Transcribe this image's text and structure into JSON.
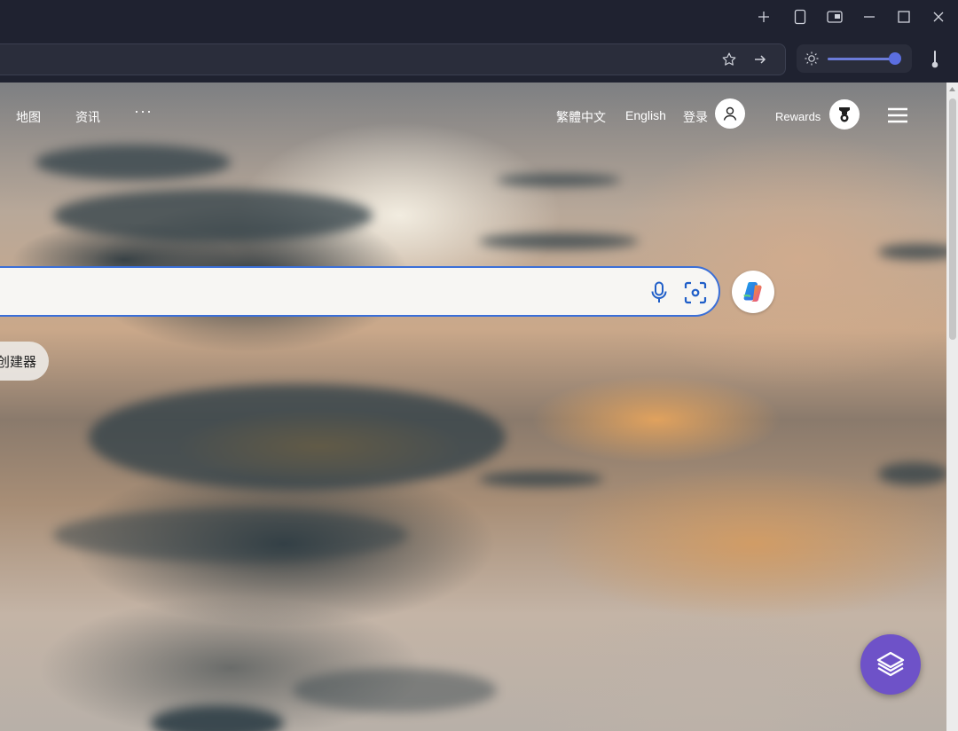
{
  "window": {
    "controls": [
      "new-tab",
      "tab-actions",
      "picture-in-picture",
      "minimize",
      "maximize",
      "close"
    ]
  },
  "address_bar": {
    "actions": [
      "favorite-star-icon",
      "forward-arrow-icon"
    ]
  },
  "brightness": {
    "level_fraction": 0.95
  },
  "nav": {
    "left_links": [
      "地图",
      "资讯"
    ],
    "more": "···",
    "right": {
      "lang_trad": "繁體中文",
      "lang_en": "English",
      "login": "登录",
      "rewards": "Rewards"
    }
  },
  "search": {
    "value": "",
    "icons": [
      "microphone-icon",
      "visual-search-icon"
    ]
  },
  "chip": {
    "label": "创建器"
  },
  "colors": {
    "search_border": "#3a6fd8",
    "layers_button": "#6e52c8",
    "slider_knob": "#5b6ee0",
    "chrome_bg": "#1f2230"
  }
}
